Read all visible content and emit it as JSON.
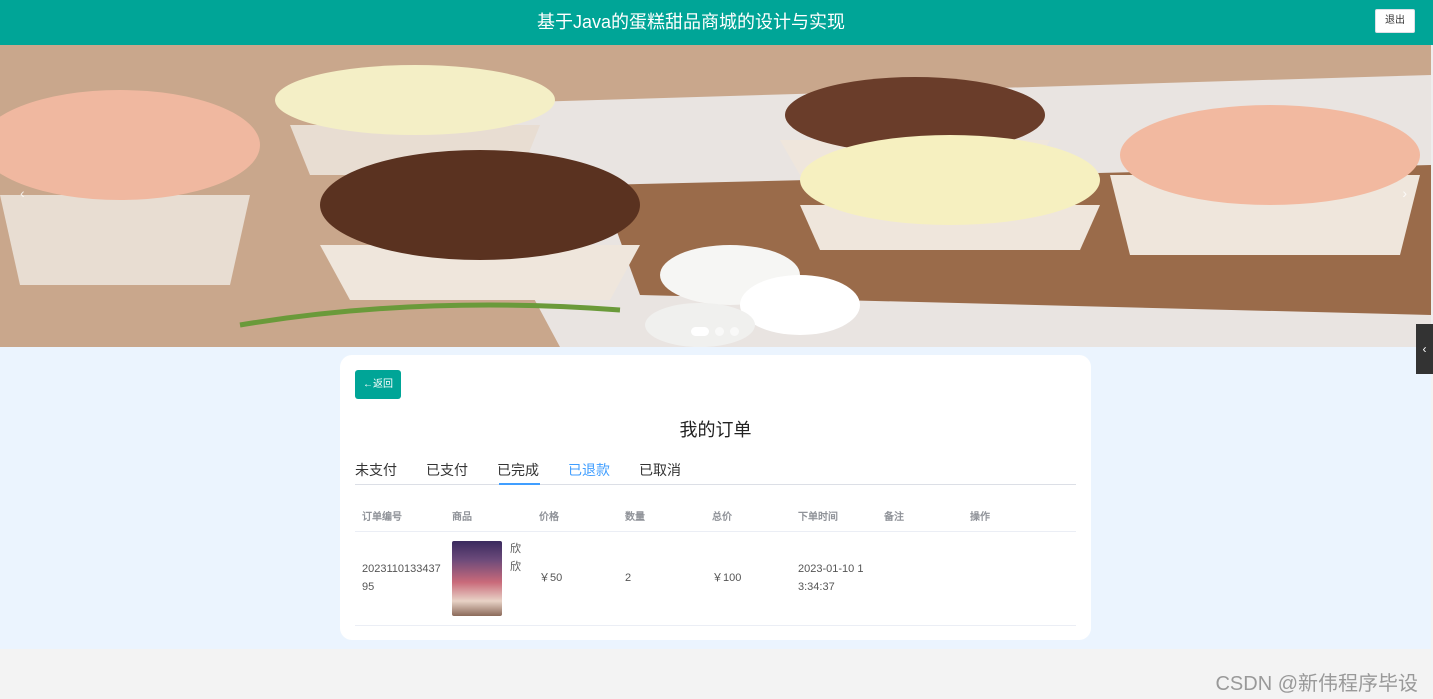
{
  "header": {
    "title": "基于Java的蛋糕甜品商城的设计与实现",
    "logout_label": "退出"
  },
  "banner": {
    "slide_count": 3,
    "active_slide": 1,
    "prev_icon": "chevron-left-icon",
    "next_icon": "chevron-right-icon"
  },
  "orders": {
    "back_label": "←返回",
    "title": "我的订单",
    "tabs": [
      "未支付",
      "已支付",
      "已完成",
      "已退款",
      "已取消"
    ],
    "selected_tab": "已退款",
    "columns": [
      "订单编号",
      "商品",
      "价格",
      "数量",
      "总价",
      "下单时间",
      "备注",
      "操作"
    ],
    "rows": [
      {
        "order_no": "202311013343795",
        "product_name": "欣欣",
        "price": "￥50",
        "quantity": "2",
        "total": "￥100",
        "time": "2023-01-10 13:34:37",
        "remark": "",
        "action": ""
      }
    ]
  },
  "side_toggle_icon": "chevron-left-icon",
  "watermark": "CSDN @新伟程序毕设",
  "colors": {
    "primary": "#00a597",
    "tab_active": "#409eff",
    "content_bg": "#ebf4fe"
  }
}
